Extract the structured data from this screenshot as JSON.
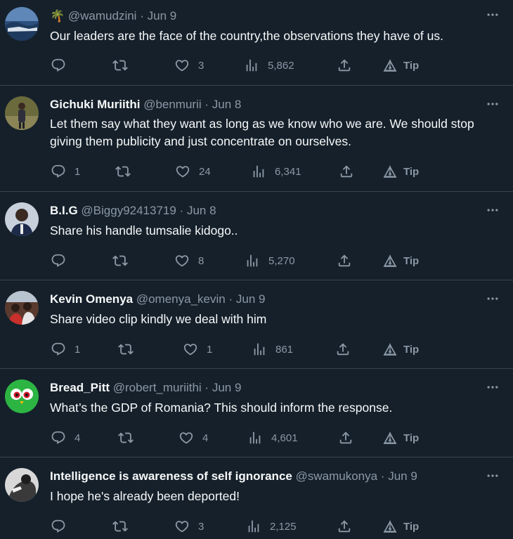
{
  "tweets": [
    {
      "name": "",
      "handle_prefix": "🌴 ",
      "handle": "@wamudzini",
      "sep": "·",
      "date": "Jun 9",
      "text": "Our leaders are the face of the country,the observations they have of us.",
      "replies": "",
      "retweets": "",
      "likes": "3",
      "views": "5,862",
      "tip": "Tip"
    },
    {
      "name": "Gichuki Muriithi",
      "handle_prefix": "",
      "handle": "@benmurii",
      "sep": "·",
      "date": "Jun 8",
      "text": "Let them say what they want as long as we know who we are. We should stop giving them publicity and just concentrate on ourselves.",
      "replies": "1",
      "retweets": "",
      "likes": "24",
      "views": "6,341",
      "tip": "Tip"
    },
    {
      "name": "B.I.G",
      "handle_prefix": "",
      "handle": "@Biggy92413719",
      "sep": "·",
      "date": "Jun 8",
      "text": "Share his handle tumsalie kidogo..",
      "replies": "",
      "retweets": "",
      "likes": "8",
      "views": "5,270",
      "tip": "Tip"
    },
    {
      "name": "Kevin Omenya",
      "handle_prefix": "",
      "handle": "@omenya_kevin",
      "sep": "·",
      "date": "Jun 9",
      "text": "Share video clip kindly we deal with him",
      "replies": "1",
      "retweets": "",
      "likes": "1",
      "views": "861",
      "tip": "Tip"
    },
    {
      "name": "Bread_Pitt",
      "handle_prefix": "",
      "handle": "@robert_muriithi",
      "sep": "·",
      "date": "Jun 9",
      "text": "What’s the GDP of Romania? This should inform the response.",
      "replies": "4",
      "retweets": "",
      "likes": "4",
      "views": "4,601",
      "tip": "Tip"
    },
    {
      "name": "Intelligence is awareness of self ignorance",
      "handle_prefix": "",
      "handle": "@swamukonya",
      "sep": "·",
      "date": "Jun 9",
      "text": "I hope he's already been deported!",
      "replies": "",
      "retweets": "",
      "likes": "3",
      "views": "2,125",
      "tip": "Tip"
    }
  ],
  "icons": {
    "reply": "reply-icon",
    "retweet": "retweet-icon",
    "like": "like-icon",
    "views": "views-icon",
    "share": "share-icon",
    "tip": "tip-icon",
    "more": "more-icon"
  },
  "colors": {
    "background": "#15202b",
    "divider": "#38444d",
    "text_primary": "#f7f9f9",
    "text_secondary": "#8b98a5"
  }
}
